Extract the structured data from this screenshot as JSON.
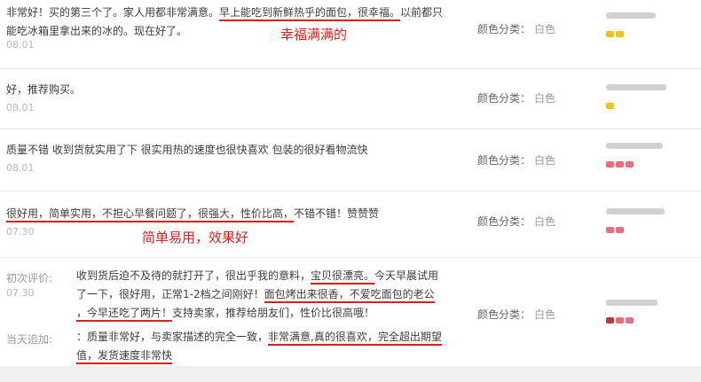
{
  "sku_label": "颜色分类：",
  "sku_value": "白色",
  "reviews": [
    {
      "line1a": "非常好！买的第三个了。家人用都非常满意。",
      "line1b": "早上能吃到新鲜热乎的面包，很幸福。",
      "line1c": "以前都只",
      "line2": "能吃冰箱里拿出来的冰的。现在好了。",
      "date": "08.01",
      "note": "幸福满满的"
    },
    {
      "line1": "好，推荐购买。",
      "date": "08.01"
    },
    {
      "line1": "质量不错 收到货就实用了下 很实用热的速度也很快喜欢 包装的很好看物流快",
      "date": "08.01"
    },
    {
      "line1a": "很好用，简单实用，不担心早餐问题了，很强大，性价比高，",
      "line1b": "不错不错！赞赞赞",
      "date": "07.30",
      "note": "简单易用，效果好"
    },
    {
      "first_label": "初次评价:",
      "date": "07.30",
      "f1a": "收到货后迫不及待的就打开了，很出乎我的意料，",
      "f1b": "宝贝很漂亮。",
      "f1c": "今天早晨试用",
      "f2a": "了一下，很好用，正常1-2档之间刚好！",
      "f2b": "面包烤出来很香，不爱吃面包的老公",
      "f3a": "，今早还吃了两片！",
      "f3b": "支持卖家，推荐给朋友们，性价比很高哦！",
      "append_label": "当天追加:",
      "a1a": "：质量非常好，与卖家描述的完全一致，",
      "a1b": "非常满意,真的很喜欢，完全超出期望",
      "a2": "值，发货速度非常快"
    }
  ]
}
